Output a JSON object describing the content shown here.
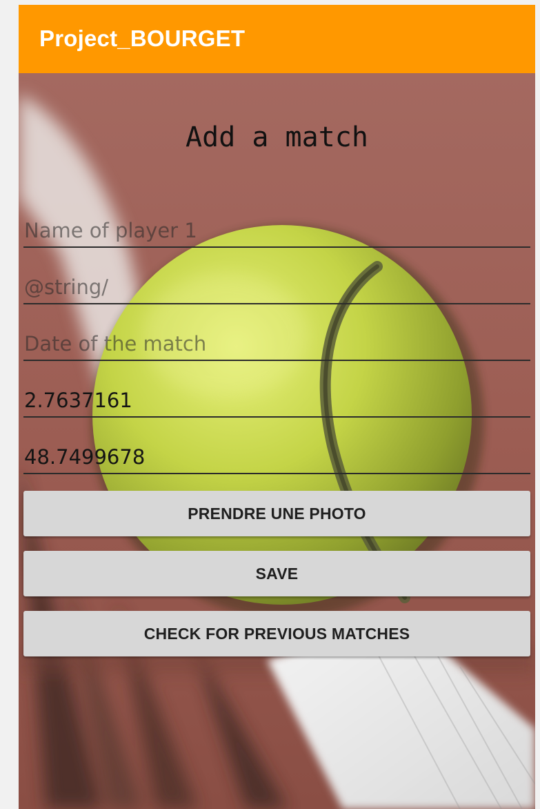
{
  "app_bar": {
    "title": "Project_BOURGET",
    "color": "#ff9800"
  },
  "form": {
    "heading": "Add a match",
    "fields": [
      {
        "placeholder": "Name of player 1",
        "value": ""
      },
      {
        "placeholder": "@string/",
        "value": ""
      },
      {
        "placeholder": "Date of the match",
        "value": ""
      },
      {
        "placeholder": "",
        "value": "2.7637161"
      },
      {
        "placeholder": "",
        "value": "48.7499678"
      }
    ],
    "buttons": {
      "photo": "PRENDRE UNE PHOTO",
      "save": "SAVE",
      "previous": "CHECK FOR PREVIOUS MATCHES"
    }
  },
  "background": {
    "icon": "tennis-ball-net-photo",
    "court_color": "#a0635a",
    "ball_color": "#c9d94a"
  }
}
